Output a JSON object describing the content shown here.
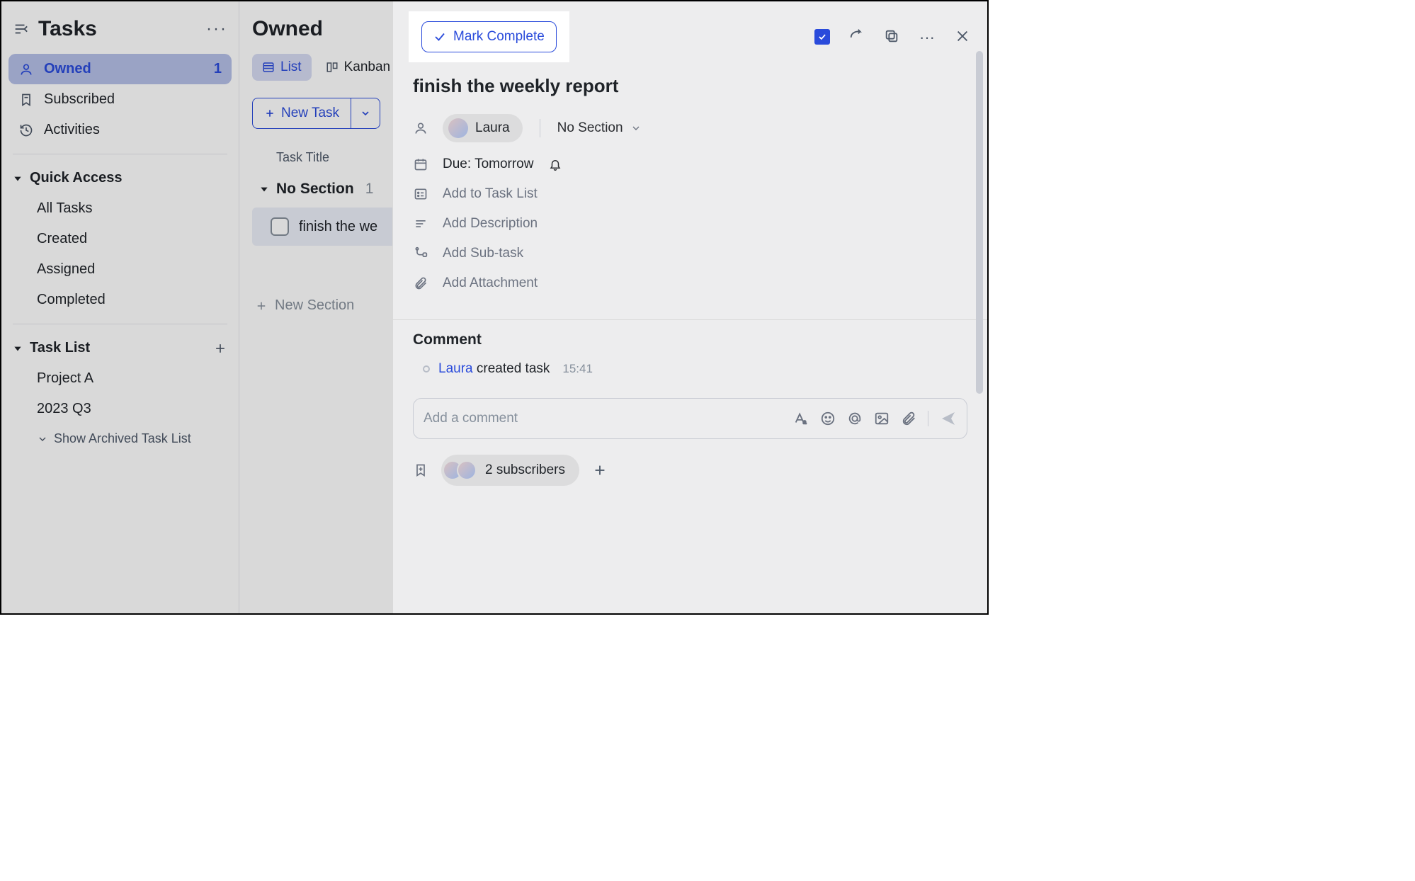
{
  "sidebar": {
    "title": "Tasks",
    "nav": {
      "owned": {
        "label": "Owned",
        "count": "1"
      },
      "subscribed_label": "Subscribed",
      "activities_label": "Activities"
    },
    "quick_access": {
      "heading": "Quick Access",
      "items": [
        "All Tasks",
        "Created",
        "Assigned",
        "Completed"
      ]
    },
    "task_list": {
      "heading": "Task List",
      "items": [
        "Project A",
        "2023 Q3"
      ],
      "archived_label": "Show Archived Task List"
    }
  },
  "middle": {
    "title": "Owned",
    "tabs": {
      "list": "List",
      "kanban": "Kanban"
    },
    "new_task_btn": "New Task",
    "column_header": "Task Title",
    "section": {
      "name": "No Section",
      "count": "1"
    },
    "task_row_title": "finish the we",
    "new_task_text": "New Task",
    "new_section": "New Section"
  },
  "panel": {
    "mark_complete": "Mark Complete",
    "title": "finish the weekly report",
    "assignee": "Laura",
    "section_select": "No Section",
    "due_text": "Due: Tomorrow",
    "add_task_list": "Add to Task List",
    "add_description": "Add Description",
    "add_subtask": "Add Sub-task",
    "add_attachment": "Add Attachment",
    "comment_heading": "Comment",
    "activity": {
      "user": "Laura",
      "action": " created task",
      "time": "15:41"
    },
    "comment_placeholder": "Add a comment",
    "subscribers_text": "2 subscribers"
  }
}
